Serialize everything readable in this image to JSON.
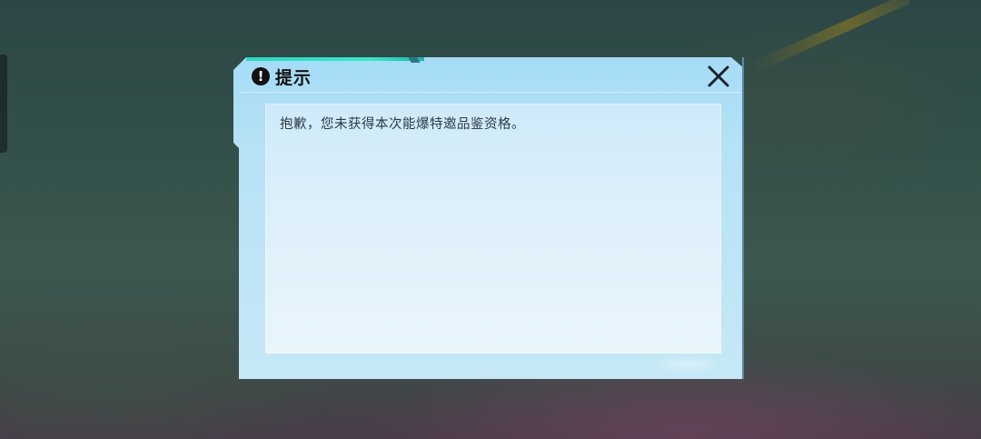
{
  "dialog": {
    "title": "提示",
    "title_icon": "!",
    "message": "抱歉，您未获得本次能爆特邀品鉴资格。",
    "icons": {
      "title": "exclamation-circle-icon",
      "close": "close-x-icon"
    }
  },
  "colors": {
    "accent": "#28d8c0",
    "dialog_bg": "#a6dcf6",
    "panel_bg": "#dff0fa",
    "text": "#2c3a44",
    "title_text": "#111111"
  }
}
